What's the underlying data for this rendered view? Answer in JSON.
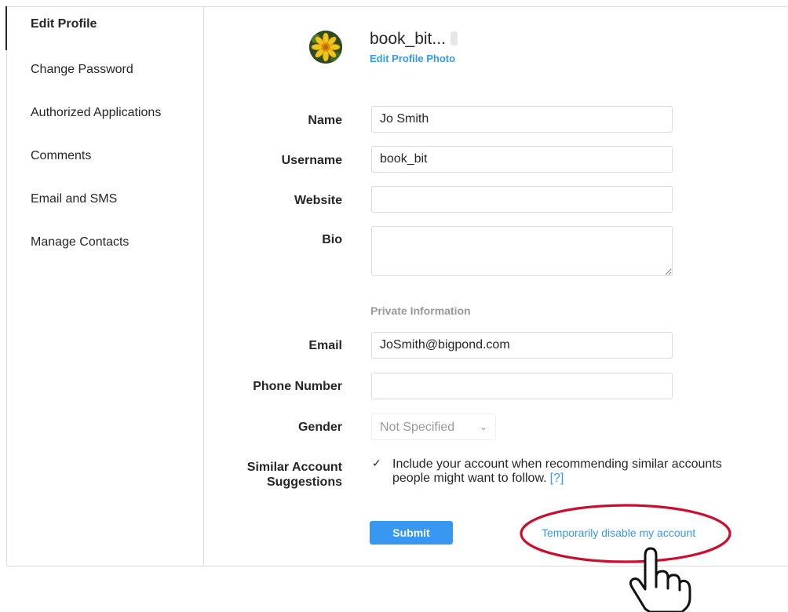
{
  "sidebar": {
    "items": [
      {
        "label": "Edit Profile"
      },
      {
        "label": "Change Password"
      },
      {
        "label": "Authorized Applications"
      },
      {
        "label": "Comments"
      },
      {
        "label": "Email and SMS"
      },
      {
        "label": "Manage Contacts"
      }
    ]
  },
  "profile": {
    "username_heading": "book_bit...",
    "edit_photo_label": "Edit Profile Photo",
    "avatar_icon": "sunflower-avatar"
  },
  "form": {
    "name": {
      "label": "Name",
      "value": "Jo Smith"
    },
    "username": {
      "label": "Username",
      "value": "book_bit"
    },
    "website": {
      "label": "Website",
      "value": ""
    },
    "bio": {
      "label": "Bio",
      "value": ""
    },
    "private_section_title": "Private Information",
    "email": {
      "label": "Email",
      "value": "JoSmith@bigpond.com"
    },
    "phone": {
      "label": "Phone Number",
      "value": ""
    },
    "gender": {
      "label": "Gender",
      "selected": "Not Specified"
    },
    "similar": {
      "label_line1": "Similar Account",
      "label_line2": "Suggestions",
      "checked": true,
      "text": "Include your account when recommending similar accounts people might want to follow.",
      "help_label": "[?]"
    },
    "submit_label": "Submit",
    "disable_label": "Temporarily disable my account"
  },
  "colors": {
    "accent": "#3897f0",
    "annotation": "#c8102e",
    "text": "#262626",
    "muted": "#999999",
    "border": "#dbdbdb"
  }
}
